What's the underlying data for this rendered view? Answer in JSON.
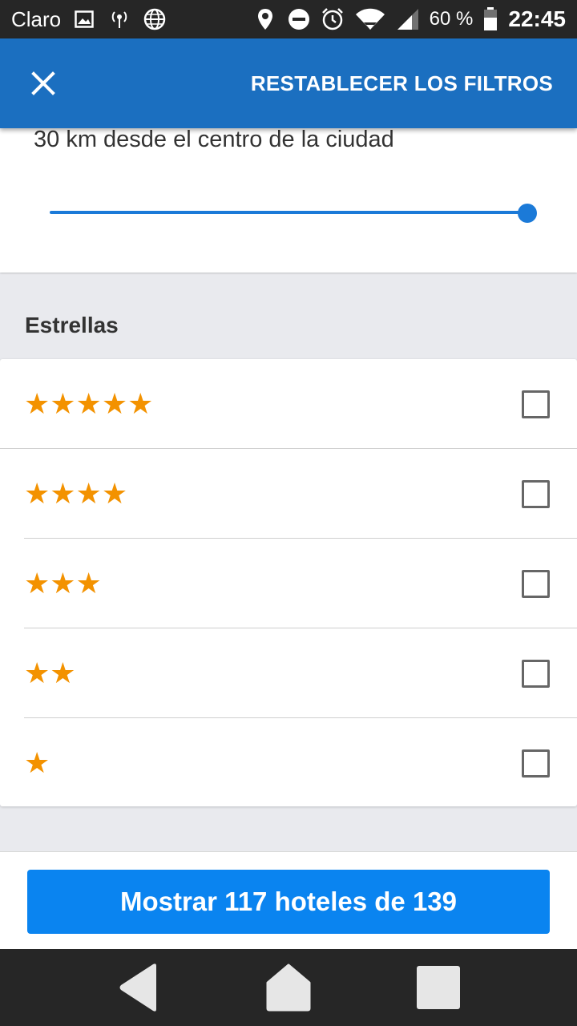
{
  "status_bar": {
    "carrier": "Claro",
    "battery_percent": "60 %",
    "time": "22:45",
    "icons": [
      "image-icon",
      "hotspot-icon",
      "globe-icon",
      "location-icon",
      "do-not-disturb-icon",
      "alarm-icon",
      "wifi-icon",
      "signal-icon",
      "battery-icon"
    ]
  },
  "app_bar": {
    "close_icon": "close-icon",
    "reset_label": "RESTABLECER LOS FILTROS",
    "background_color": "#1b6fc0"
  },
  "distance": {
    "label": "30 km desde el centro de la ciudad",
    "slider_value_fraction": 1.0
  },
  "stars_section": {
    "title": "Estrellas",
    "rows": [
      {
        "stars": "★★★★★",
        "checked": false
      },
      {
        "stars": "★★★★",
        "checked": false
      },
      {
        "stars": "★★★",
        "checked": false
      },
      {
        "stars": "★★",
        "checked": false
      },
      {
        "stars": "★",
        "checked": false
      }
    ],
    "star_color": "#f39200"
  },
  "action": {
    "show_button_label": "Mostrar 117 hoteles de 139",
    "button_color": "#0a84f0"
  },
  "nav_bar": {
    "icons": [
      "back-icon",
      "home-icon",
      "recents-icon"
    ]
  }
}
